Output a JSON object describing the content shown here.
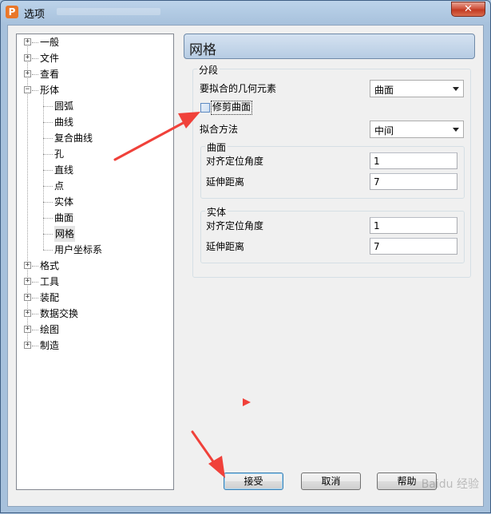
{
  "window": {
    "title": "选项",
    "app_icon_letter": "P",
    "close_symbol": "✕"
  },
  "tree": {
    "items": [
      {
        "label": "一般",
        "expander": "+"
      },
      {
        "label": "文件",
        "expander": "+"
      },
      {
        "label": "查看",
        "expander": "+"
      },
      {
        "label": "形体",
        "expander": "−"
      },
      {
        "label": "圆弧"
      },
      {
        "label": "曲线"
      },
      {
        "label": "复合曲线"
      },
      {
        "label": "孔"
      },
      {
        "label": "直线"
      },
      {
        "label": "点"
      },
      {
        "label": "实体"
      },
      {
        "label": "曲面"
      },
      {
        "label": "网格",
        "selected": true
      },
      {
        "label": "用户坐标系"
      },
      {
        "label": "格式",
        "expander": "+"
      },
      {
        "label": "工具",
        "expander": "+"
      },
      {
        "label": "装配",
        "expander": "+"
      },
      {
        "label": "数据交换",
        "expander": "+"
      },
      {
        "label": "绘图",
        "expander": "+"
      },
      {
        "label": "制造",
        "expander": "+"
      }
    ]
  },
  "panel": {
    "title": "网格",
    "segment_group": {
      "title": "分段",
      "fit_element_label": "要拟合的几何元素",
      "fit_element_value": "曲面",
      "trim_surface_label": "修剪曲面",
      "trim_surface_checked": false,
      "fit_method_label": "拟合方法",
      "fit_method_value": "中间"
    },
    "surface_group": {
      "title": "曲面",
      "align_angle_label": "对齐定位角度",
      "align_angle_value": "1",
      "extend_distance_label": "延伸距离",
      "extend_distance_value": "7"
    },
    "solid_group": {
      "title": "实体",
      "align_angle_label": "对齐定位角度",
      "align_angle_value": "1",
      "extend_distance_label": "延伸距离",
      "extend_distance_value": "7"
    }
  },
  "buttons": {
    "accept": "接受",
    "cancel": "取消",
    "help": "帮助"
  },
  "watermark": "Baidu 经验",
  "colors": {
    "annotation_arrow": "#f0413a",
    "window_frame": "#a7c1dc"
  }
}
